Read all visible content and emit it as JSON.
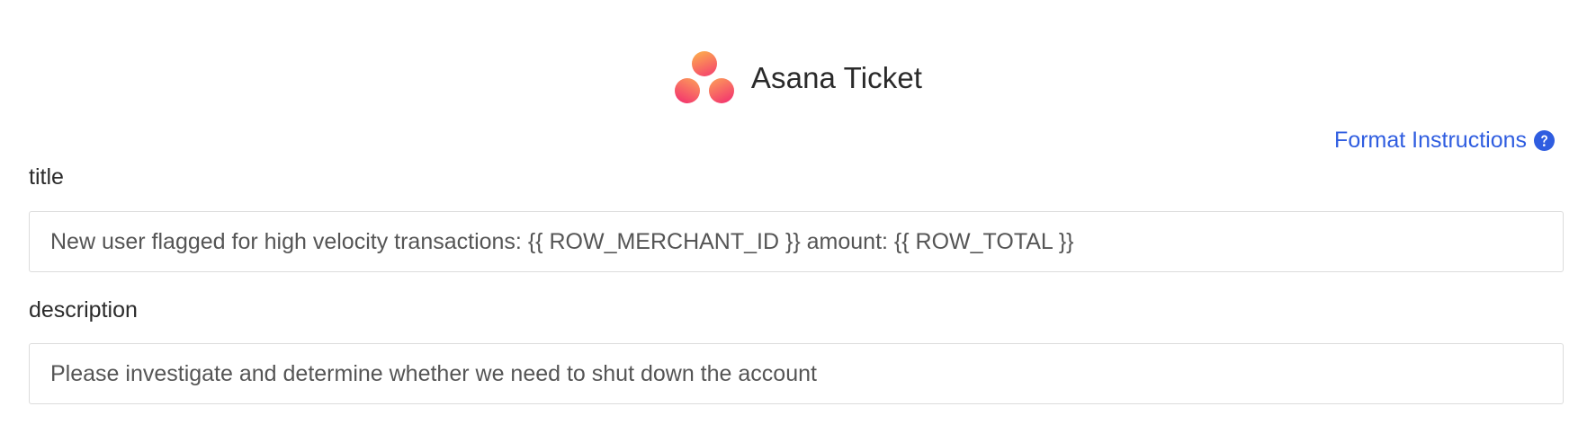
{
  "header": {
    "title": "Asana Ticket",
    "logo_icon": "asana-logo-icon"
  },
  "format_instructions": {
    "label": "Format Instructions",
    "icon": "question-circle-icon",
    "color": "#2f5de0"
  },
  "fields": {
    "title": {
      "label": "title",
      "value": "New user flagged for high velocity transactions: {{ ROW_MERCHANT_ID }} amount: {{ ROW_TOTAL }}"
    },
    "description": {
      "label": "description",
      "value": "Please investigate and determine whether we need to shut down the account"
    }
  },
  "colors": {
    "logo_top": "#fdb44b",
    "logo_mid": "#fc7a6b",
    "logo_bottom": "#f3366e",
    "border": "#dcdcdc",
    "text": "#2b2b2b"
  }
}
